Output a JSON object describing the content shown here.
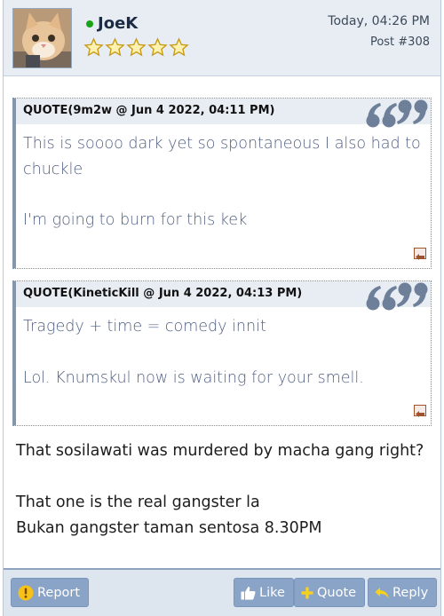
{
  "author": {
    "username": "JoeK",
    "online": true,
    "rating_stars": 5
  },
  "post": {
    "date": "Today, 04:26 PM",
    "number": "Post #308"
  },
  "quotes": [
    {
      "header": "QUOTE(9m2w @ Jun 4 2022, 04:11 PM)",
      "lines": [
        "This is soooo dark yet so spontaneous I also had to",
        "chuckle",
        "",
        "I'm going to burn for this kek"
      ]
    },
    {
      "header": "QUOTE(KineticKill @ Jun 4 2022, 04:13 PM)",
      "lines": [
        "Tragedy + time = comedy innit",
        "",
        "Lol. Knumskul now is waiting for your smell."
      ]
    }
  ],
  "message": {
    "lines": [
      "That sosilawati was murdered by macha gang right?",
      "",
      "That one is the real gangster la",
      "Bukan gangster taman sentosa 8.30PM"
    ]
  },
  "footer": {
    "report_label": "Report",
    "like_label": "Like",
    "quote_label": "Quote",
    "reply_label": "Reply"
  },
  "colors": {
    "online": "#17a417",
    "button": "#8aa4c8",
    "quote_text": "#4f5f84",
    "star_fill": "#fff1b0",
    "star_stroke": "#c79a16"
  }
}
